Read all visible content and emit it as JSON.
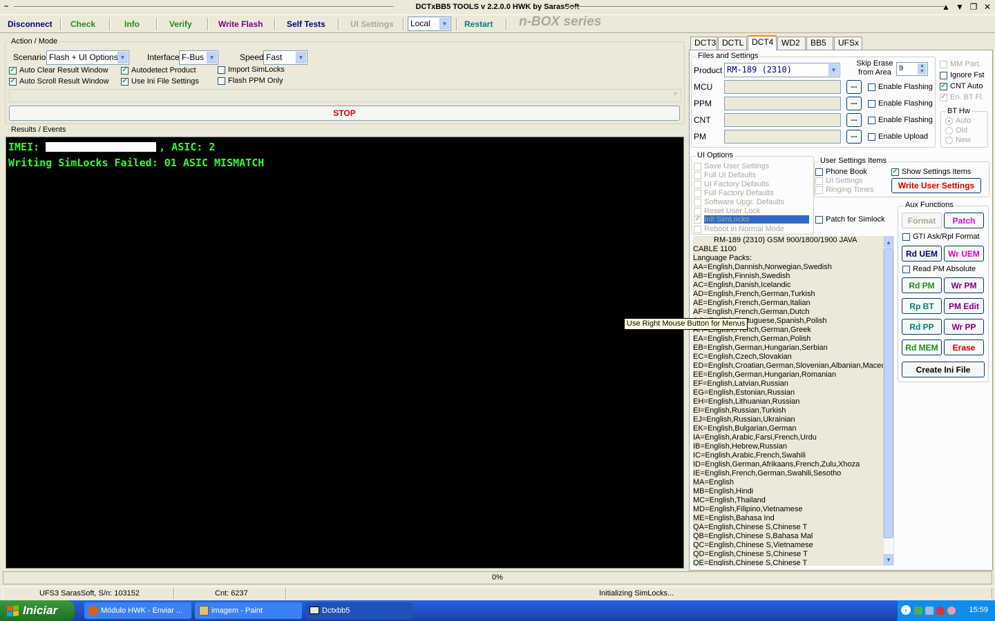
{
  "window": {
    "title": "DCTxBB5 TOOLS v 2.2.0.0 HWK by SarasSoft"
  },
  "toolbar": {
    "disconnect": "Disconnect",
    "check": "Check",
    "info": "Info",
    "verify": "Verify",
    "write_flash": "Write Flash",
    "self_tests": "Self Tests",
    "ui_settings": "UI Settings",
    "local": "Local",
    "restart": "Restart",
    "brand": "n-BOX series"
  },
  "action_mode": {
    "title": "Action / Mode",
    "scenario_label": "Scenario",
    "scenario_value": "Flash + UI Options",
    "interface_label": "Interface",
    "interface_value": "F-Bus",
    "speed_label": "Speed",
    "speed_value": "Fast",
    "auto_clear": "Auto Clear Result Window",
    "auto_scroll": "Auto Scroll Result Window",
    "autodetect": "Autodetect Product",
    "use_ini": "Use Ini File Settings",
    "import_simlocks": "Import SimLocks",
    "flash_ppm": "Flash PPM Only",
    "stop": "STOP"
  },
  "results": {
    "title": "Results / Events",
    "line1_prefix": "IMEI:",
    "line1_suffix": ", ASIC: 2",
    "line2": "Writing SimLocks Failed: 01 ASIC MISMATCH"
  },
  "tabs": [
    "DCT3",
    "DCTL",
    "DCT4",
    "WD2",
    "BB5",
    "UFSx"
  ],
  "files": {
    "title": "Files and Settings",
    "product_label": "Product",
    "product_value": "RM-189  (2310)",
    "skip_erase_label": "Skip Erase from Area",
    "skip_erase_value": "9",
    "mcu": "MCU",
    "ppm": "PPM",
    "cnt": "CNT",
    "pm": "PM",
    "dots": "...",
    "enable_flashing": "Enable Flashing",
    "enable_upload": "Enable Upload",
    "mm_part": "MM Part.",
    "ignore_fst": "Ignore Fst",
    "cnt_auto": "CNT Auto",
    "en_bt_fl": "En. BT Fl.",
    "bt_hw": "BT Hw",
    "auto": "Auto",
    "old": "Old",
    "new": "New"
  },
  "ui_options": {
    "title": "UI Options",
    "items": [
      "Save User Settings",
      "Full UI Defaults",
      "UI Factory Defaults",
      "Full Factory Defaults",
      "Software Upgr. Defaults",
      "Reset User Lock",
      "Init SimLocks",
      "Reboot in Normal Mode"
    ],
    "patch_simlock": "Patch for Simlock"
  },
  "user_settings": {
    "title": "User Settings Items",
    "phone_book": "Phone Book",
    "ui_settings": "UI Settings",
    "ringing_tones": "Ringing Tones",
    "show_settings": "Show Settings Items",
    "write_user_settings": "Write User Settings"
  },
  "aux": {
    "title": "Aux Functions",
    "format": "Format",
    "patch": "Patch",
    "gti": "GTI Ask/Rpl Format",
    "rd_uem": "Rd UEM",
    "wr_uem": "Wr UEM",
    "read_pm_abs": "Read PM Absolute",
    "rd_pm": "Rd PM",
    "wr_pm": "Wr PM",
    "rp_bt": "Rp BT",
    "pm_edit": "PM Edit",
    "rd_pp": "Rd PP",
    "wr_pp": "Wr PP",
    "rd_mem": "Rd MEM",
    "erase": "Erase",
    "create_ini": "Create Ini File"
  },
  "info_list": [
    "RM-189 (2310) GSM 900/1800/1900 JAVA",
    "CABLE 1100",
    "Language Packs:",
    "AA=English,Dannish,Norwegian,Swedish",
    "AB=English,Finnish,Swedish",
    "AC=English,Danish,Icelandic",
    "AD=English,French,German,Turkish",
    "AE=English,French,German,Italian",
    "AF=English,French,German,Dutch",
    "AG=English,Portuguese,Spanish,Polish",
    "AH=English,French,German,Greek",
    "EA=English,French,German,Polish",
    "EB=English,German,Hungarian,Serbian",
    "EC=English,Czech,Slovakian",
    "ED=English,Croatian,German,Slovenian,Albanian,Macedonian",
    "EE=English,German,Hungarian,Romanian",
    "EF=English,Latvian,Russian",
    "EG=English,Estonian,Russian",
    "EH=English,Lithuanian,Russian",
    "EI=English,Russian,Turkish",
    "EJ=English,Russian,Ukrainian",
    "EK=English,Bulgarian,German",
    "IA=English,Arabic,Farsi,French,Urdu",
    "IB=English,Hebrew,Russian",
    "IC=English,Arabic,French,Swahili",
    "ID=English,German,Afrikaans,French,Zulu,Xhoza",
    "IE=English,French,German,Swahili,Sesotho",
    "MA=English",
    "MB=English,Hindi",
    "MC=English,Thailand",
    "MD=English,Filipino,Vietnamese",
    "ME=English,Bahasa Ind",
    "QA=English,Chinese S,Chinese T",
    "QB=English,Chinese S,Bahasa Mal",
    "QC=English,Chinese S,Vietnamese",
    "QD=English,Chinese S,Chinese T",
    "QE=English,Chinese S,Chinese T"
  ],
  "tooltip": "Use Right Mouse Button for Menus",
  "progress": {
    "text": "0%",
    "value": 0
  },
  "status": {
    "left": "UFS3 SarasSoft, S/n: 103152",
    "cnt": "Cnt: 6237",
    "msg": "Initializing SimLocks..."
  },
  "taskbar": {
    "start": "Iniciar",
    "tasks": [
      "Módulo HWK - Enviar ...",
      "imagem - Paint",
      "Dctxbb5"
    ],
    "clock": "15:59"
  },
  "colors": {
    "green": "#1e8c1e",
    "purple": "#800080",
    "blue": "#00008b",
    "red": "#d00000",
    "magenta": "#e000e0",
    "console_text": "#32ff32"
  }
}
